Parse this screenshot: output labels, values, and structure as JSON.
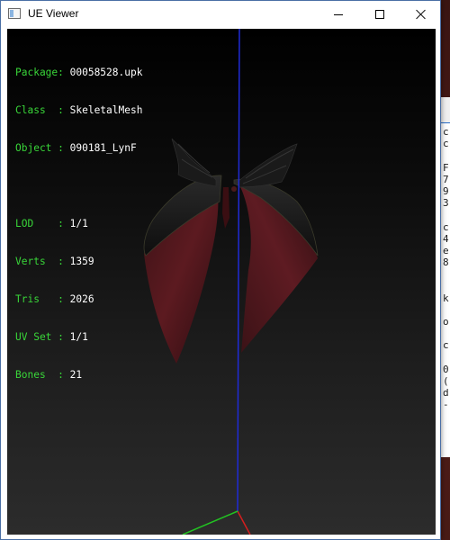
{
  "window": {
    "title": "UE Viewer",
    "icon": "app-window-icon",
    "controls": {
      "minimize": "minimize-icon",
      "maximize": "maximize-icon",
      "close": "close-icon"
    }
  },
  "info": {
    "package_label": "Package: ",
    "package_value": "00058528.upk",
    "class_label": "Class  : ",
    "class_value": "SkeletalMesh",
    "object_label": "Object : ",
    "object_value": "090181_LynF",
    "lod_label": "LOD    : ",
    "lod_value": "1/1",
    "verts_label": "Verts  : ",
    "verts_value": "1359",
    "tris_label": "Tris   : ",
    "tris_value": "2026",
    "uvset_label": "UV Set : ",
    "uvset_value": "1/1",
    "bones_label": "Bones  : ",
    "bones_value": "21"
  },
  "background_window": {
    "lines": [
      "c",
      "c",
      "",
      "F",
      "7",
      "9",
      "3",
      "",
      "c",
      "4",
      "e",
      "8",
      "",
      "",
      "k",
      "",
      "o",
      "",
      "c",
      "",
      "0",
      "(",
      "d",
      "-"
    ]
  },
  "colors": {
    "info_key": "#39d639",
    "info_value": "#ffffff",
    "axis_y": "#1f2bd6",
    "axis_x": "#d41e1e",
    "axis_z": "#22c322",
    "cape_red": "#5a1a1e",
    "cape_dark": "#161616"
  }
}
